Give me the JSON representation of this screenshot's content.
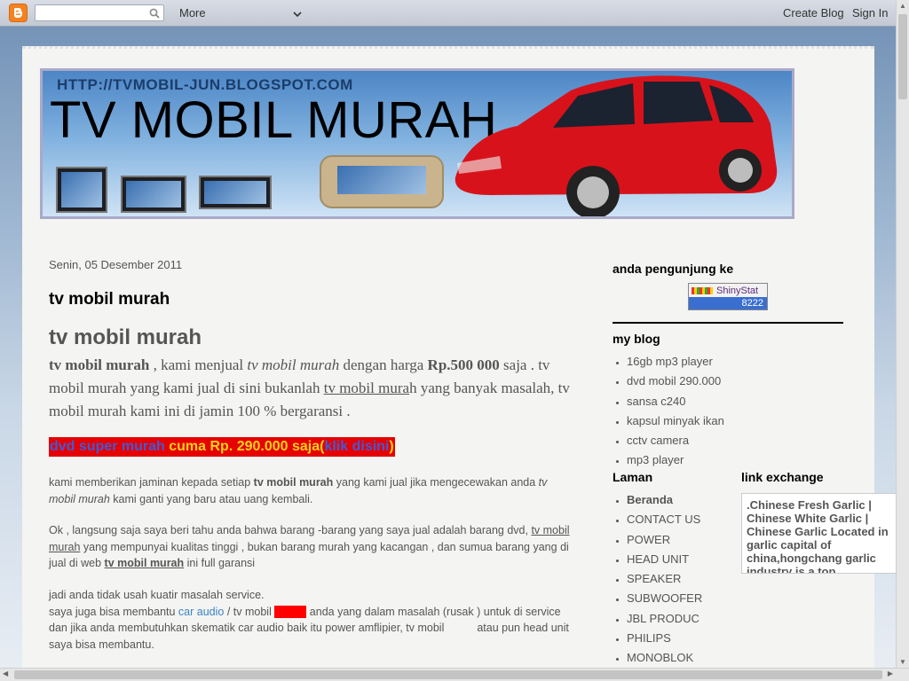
{
  "navbar": {
    "more_label": "More",
    "create_blog": "Create Blog",
    "sign_in": "Sign In"
  },
  "header": {
    "url": "HTTP://TVMOBIL-JUN.BLOGSPOT.COM",
    "title": "TV MOBIL MURAH"
  },
  "post": {
    "date": "Senin, 05 Desember 2011",
    "title": "tv mobil murah",
    "heading": "tv mobil murah",
    "intro": {
      "b1": "tv mobil murah",
      "t1": " , kami menjual ",
      "i1": "tv mobil murah",
      "t2": " dengan harga ",
      "price": "Rp.500 000",
      "t3": " saja . tv mobil murah yang kami jual di sini bukanlah ",
      "u1": "tv mobil mura",
      "t4": "h yang banyak masalah, tv mobil murah kami ini di jamin 100 % bergaransi ."
    },
    "promo": {
      "p1": "dvd super murah ",
      "p2": "cuma Rp. 290.000 saja(",
      "p3": "klik disini",
      "p4": ")"
    },
    "para1": {
      "a": "kami memberikan jaminan kepada setiap ",
      "b": "tv mobil murah",
      "c": " yang kami jual jika mengecewakan anda ",
      "d": "tv mobil murah",
      "e": " kami ganti yang baru atau uang kembali."
    },
    "para2": {
      "a": "Ok , langsung saja saya beri tahu anda bahwa barang -barang yang saya jual adalah barang dvd, ",
      "b": "tv mobil murah",
      "c": " yang mempunyai kualitas tinggi , bukan barang murah yang kacangan , dan sumua barang yang di jual di web ",
      "d": "tv mobil murah",
      "e": " ini full garansi"
    },
    "para3": {
      "a": "jadi anda tidak usah kuatir masalah service.",
      "b": "saya juga bisa membantu ",
      "link": "car audio",
      "c": " / tv mobil ",
      "d": " anda yang dalam masalah (rusak ) untuk di service dan jika anda membutuhkan skematik car audio baik itu power amflipier, tv mobil ",
      "e": " atau pun head unit saya bisa membantu."
    }
  },
  "sidebar": {
    "visitors_title": "anda pengunjung ke",
    "counter_brand": "ShinyStat",
    "counter_value": "8222",
    "my_blog_title": "my blog",
    "my_blog_items": [
      "16gb mp3 player",
      "dvd mobil 290.000",
      "sansa c240",
      "kapsul minyak ikan",
      "cctv camera",
      "mp3 player"
    ],
    "laman_title": "Laman",
    "laman_items": [
      "Beranda",
      "CONTACT US",
      "POWER",
      "HEAD UNIT",
      "SPEAKER",
      "SUBWOOFER",
      "JBL PRODUC",
      "PHILIPS",
      "MONOBLOK"
    ],
    "link_exchange_title": "link exchange",
    "link_exchange_text": ".Chinese Fresh Garlic | Chinese White Garlic | Chinese Garlic Located in garlic capital of china,hongchang garlic industry is a top supplier&exporter of"
  },
  "colors": {
    "promo_bg": "#e60000",
    "promo_yellow": "#ffd21a",
    "promo_blue": "#3f5bd6",
    "link_blue": "#3d85c6",
    "blogger_orange": "#f58220"
  }
}
